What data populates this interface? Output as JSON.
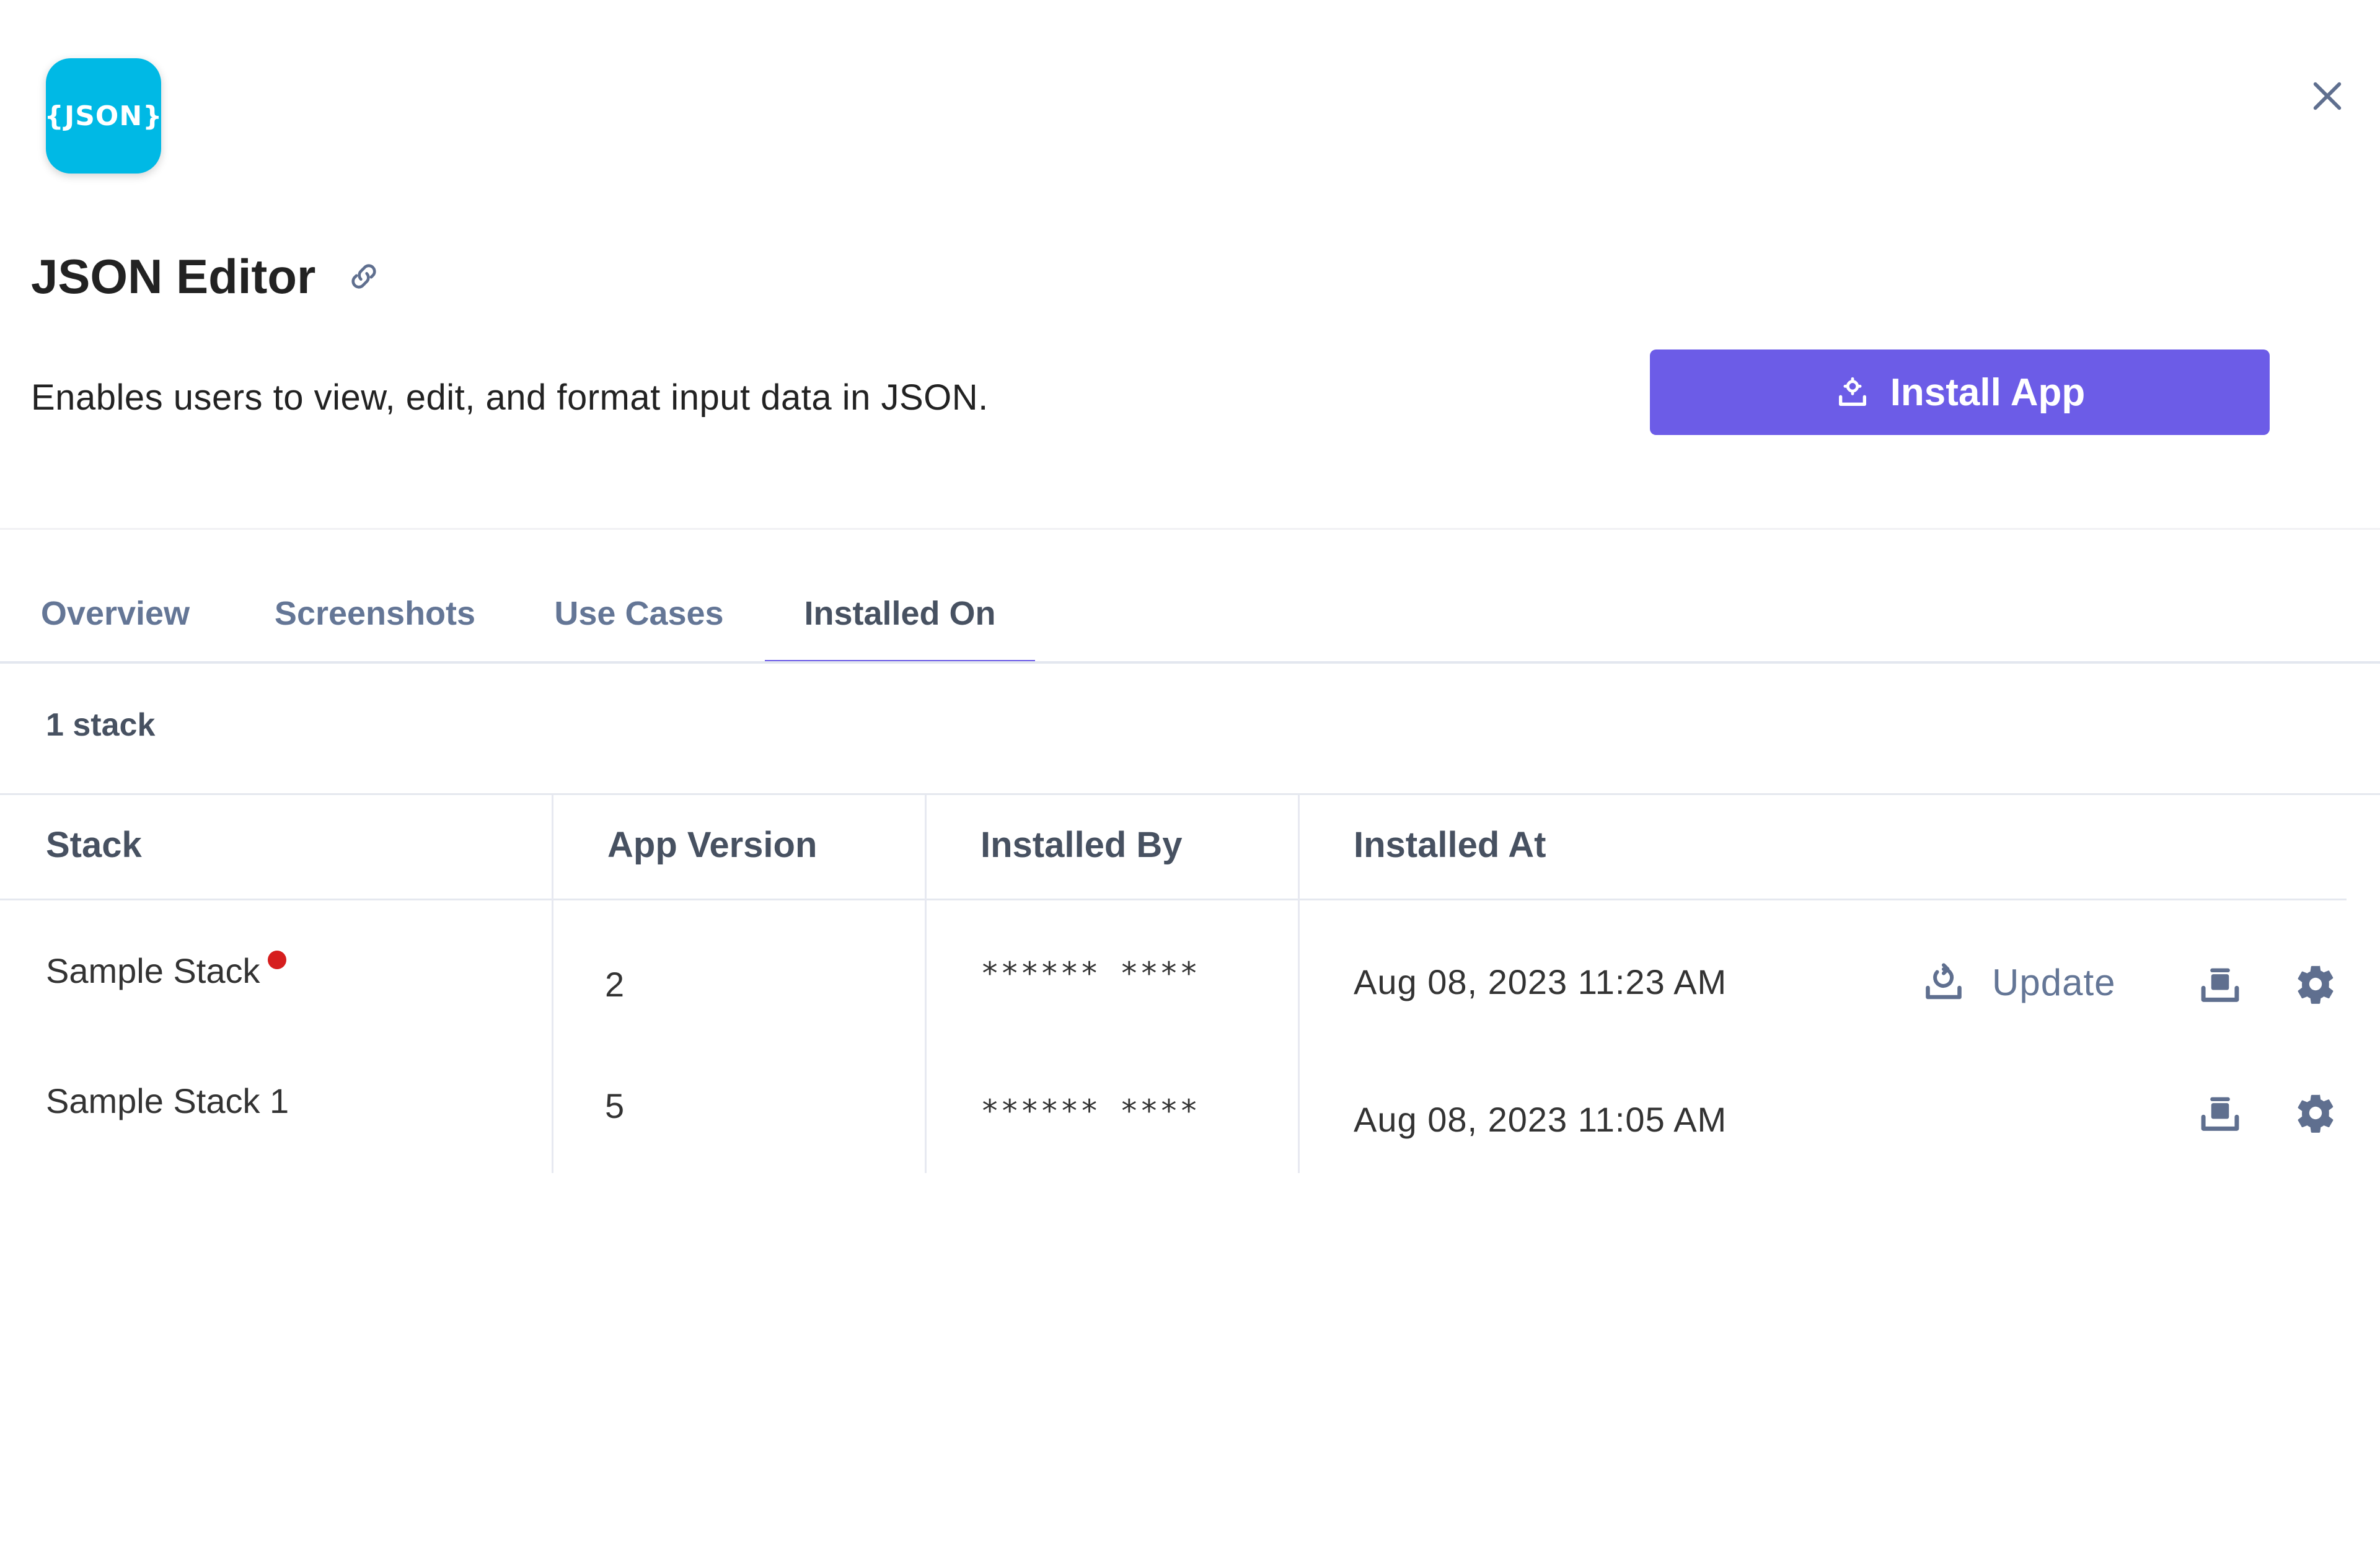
{
  "app": {
    "logo_text": "{JSON}",
    "logo_color": "#00b9e5",
    "title": "JSON Editor",
    "description": "Enables users to view, edit, and format input data in JSON.",
    "install_label": "Install App",
    "install_color": "#6c5ce7"
  },
  "tabs": [
    {
      "label": "Overview",
      "active": false
    },
    {
      "label": "Screenshots",
      "active": false
    },
    {
      "label": "Use Cases",
      "active": false
    },
    {
      "label": "Installed On",
      "active": true
    }
  ],
  "installed": {
    "count_label": "1 stack",
    "columns": [
      "Stack",
      "App Version",
      "Installed By",
      "Installed At"
    ],
    "rows": [
      {
        "stack": "Sample Stack",
        "has_alert": true,
        "version": "2",
        "installed_by": "****** ****",
        "installed_at": "Aug 08, 2023 11:23 AM",
        "update_label": "Update"
      },
      {
        "stack": "Sample Stack 1",
        "has_alert": false,
        "version": "5",
        "installed_by": "****** ****",
        "installed_at": "Aug 08, 2023 11:05 AM"
      }
    ]
  },
  "icons": {
    "close": "close-icon",
    "link": "link-icon",
    "install": "install-icon",
    "update": "update-icon",
    "uninstall": "uninstall-icon",
    "settings": "gear-icon"
  },
  "colors": {
    "alert_dot": "#d61e1e",
    "tab_text": "#647696",
    "icon_color": "#5f6f8f"
  }
}
